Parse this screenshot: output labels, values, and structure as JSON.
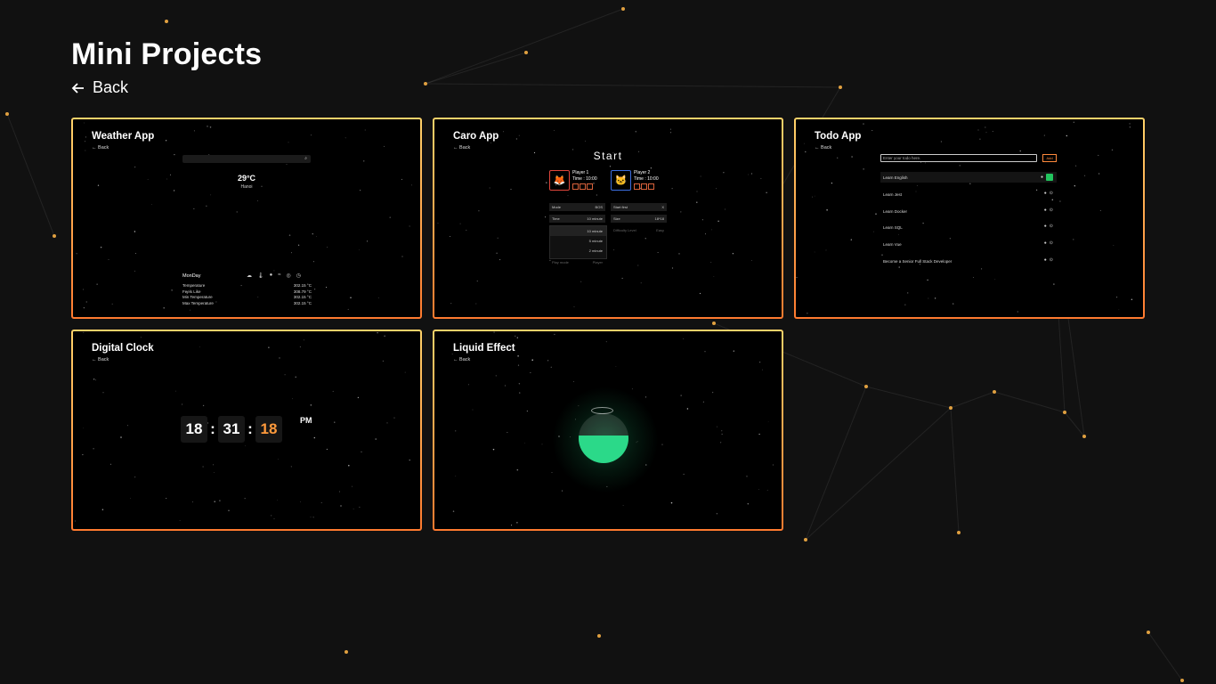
{
  "page": {
    "title": "Mini Projects",
    "back_label": "Back"
  },
  "colors": {
    "background": "#111111",
    "card_border_top": "#ffd36a",
    "card_border_bottom": "#ff7a2f",
    "node_dot": "#e0a040",
    "liquid": "#2bd989",
    "accent_orange": "#ff9a3c"
  },
  "cards": [
    {
      "title": "Weather App",
      "back_label": "Back",
      "temperature": "29°C",
      "city": "Hanoi",
      "day": "MonDay",
      "icons": [
        "cloud-icon",
        "thermometer-icon",
        "drop-icon",
        "wind-icon",
        "location-icon",
        "clock-icon"
      ],
      "rows": [
        {
          "label": "Temperature",
          "value": "302.15 °C"
        },
        {
          "label": "Feels Like",
          "value": "308.79 °C"
        },
        {
          "label": "Min Temperature",
          "value": "302.15 °C"
        },
        {
          "label": "Max Temperature",
          "value": "302.15 °C"
        }
      ]
    },
    {
      "title": "Caro App",
      "back_label": "Back",
      "start_label": "Start",
      "player1": {
        "name": "Player 1",
        "time": "Time : 10:00"
      },
      "player2": {
        "name": "Player 2",
        "time": "Time : 10:00"
      },
      "fields": {
        "mode_label": "Mode",
        "mode_value": "BOS",
        "start_first_label": "Start first",
        "start_first_value": "X",
        "time_label": "Time",
        "time_value": "10 minute",
        "size_label": "Size",
        "size_value": "18*18",
        "difficulty_label": "Difficulty Level",
        "difficulty_value": "Easy",
        "play_mode_label": "Play mode",
        "play_mode_value": "Player"
      },
      "time_options": [
        "10 minute",
        "5 minute",
        "2 minute"
      ]
    },
    {
      "title": "Todo App",
      "back_label": "Back",
      "input_placeholder": "Enter your todo here.",
      "add_label": "Add",
      "todos": [
        "Learn English",
        "Learn Jest",
        "Learn Docker",
        "Learn SQL",
        "Learn Vue",
        "Become a Senior Full Stack Developer"
      ]
    },
    {
      "title": "Digital Clock",
      "back_label": "Back",
      "hours": "18",
      "minutes": "31",
      "seconds": "18",
      "separator": ":",
      "ampm": "PM"
    },
    {
      "title": "Liquid Effect",
      "back_label": "Back",
      "fill_level": 0.55
    }
  ]
}
